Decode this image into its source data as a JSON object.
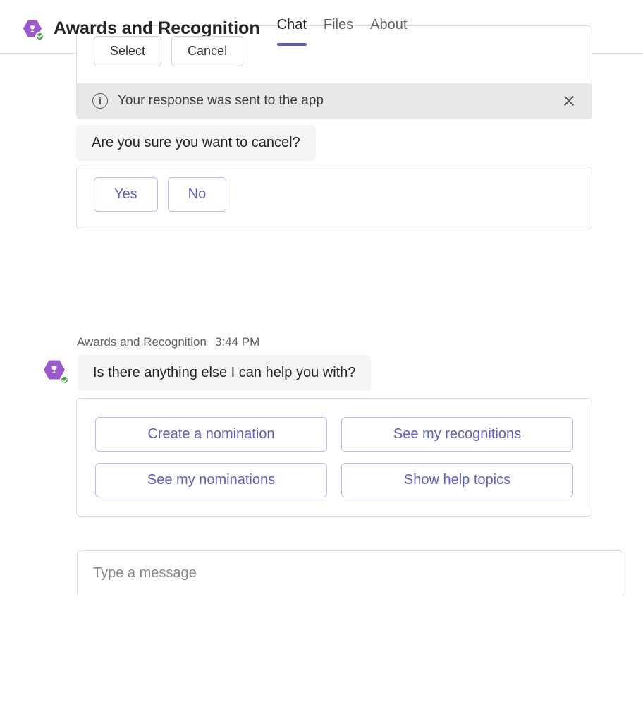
{
  "header": {
    "title": "Awards and Recognition",
    "tabs": [
      {
        "label": "Chat",
        "active": true
      },
      {
        "label": "Files",
        "active": false
      },
      {
        "label": "About",
        "active": false
      }
    ]
  },
  "conversation": {
    "prev_card": {
      "buttons": {
        "select": "Select",
        "cancel": "Cancel"
      },
      "notice": "Your response was sent to the app"
    },
    "confirm_prompt": "Are you sure you want to cancel?",
    "confirm_buttons": {
      "yes": "Yes",
      "no": "No"
    },
    "sender_name": "Awards and Recognition",
    "sender_time": "3:44 PM",
    "followup_text": "Is there anything else I can help you with?",
    "actions": [
      "Create a nomination",
      "See my recognitions",
      "See my nominations",
      "Show help topics"
    ]
  },
  "compose": {
    "placeholder": "Type a message"
  }
}
